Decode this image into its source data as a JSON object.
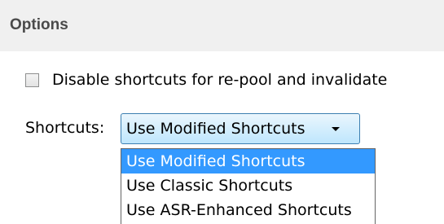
{
  "options_section": {
    "title": "Options"
  },
  "disable_shortcuts": {
    "label": "Disable shortcuts for re-pool and invalidate",
    "checked": false
  },
  "shortcuts": {
    "label": "Shortcuts:",
    "selected_value": "Use Modified Shortcuts",
    "options": [
      "Use Modified Shortcuts",
      "Use Classic Shortcuts",
      "Use ASR-Enhanced Shortcuts"
    ],
    "highlighted_index": 0
  },
  "colors": {
    "highlight": "#3399ff",
    "select_border": "#3c7fb1",
    "header_bg": "#f0f0f0"
  }
}
